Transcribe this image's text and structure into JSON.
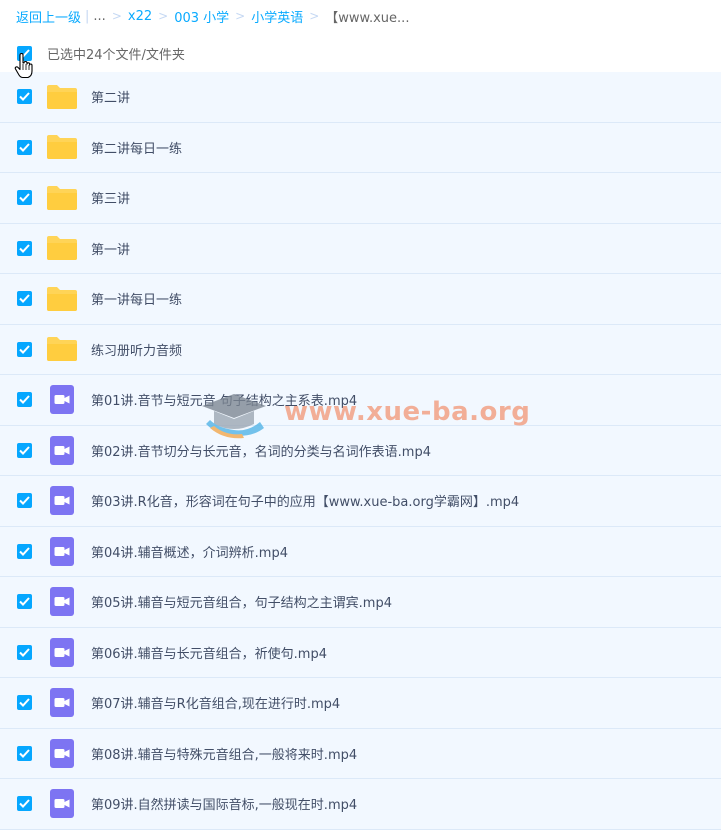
{
  "breadcrumb": {
    "back": "返回上一级",
    "ellipsis": "...",
    "items": [
      "x22",
      "003 小学",
      "小学英语"
    ],
    "current": "【www.xue..."
  },
  "selection": {
    "text": "已选中24个文件/文件夹"
  },
  "files": [
    {
      "name": "第二讲",
      "type": "folder"
    },
    {
      "name": "第二讲每日一练",
      "type": "folder"
    },
    {
      "name": "第三讲",
      "type": "folder"
    },
    {
      "name": "第一讲",
      "type": "folder"
    },
    {
      "name": "第一讲每日一练",
      "type": "folder"
    },
    {
      "name": "练习册听力音频",
      "type": "folder"
    },
    {
      "name": "第01讲.音节与短元音 句子结构之主系表.mp4",
      "type": "video"
    },
    {
      "name": "第02讲.音节切分与长元音，名词的分类与名词作表语.mp4",
      "type": "video"
    },
    {
      "name": "第03讲.R化音，形容词在句子中的应用【www.xue-ba.org学霸网】.mp4",
      "type": "video"
    },
    {
      "name": "第04讲.辅音概述，介词辨析.mp4",
      "type": "video"
    },
    {
      "name": "第05讲.辅音与短元音组合，句子结构之主谓宾.mp4",
      "type": "video"
    },
    {
      "name": "第06讲.辅音与长元音组合，祈使句.mp4",
      "type": "video"
    },
    {
      "name": "第07讲.辅音与R化音组合,现在进行时.mp4",
      "type": "video"
    },
    {
      "name": "第08讲.辅音与特殊元音组合,一般将来时.mp4",
      "type": "video"
    },
    {
      "name": "第09讲.自然拼读与国际音标,一般现在时.mp4",
      "type": "video"
    }
  ],
  "watermark": {
    "text": "www.xue-ba.org"
  },
  "colors": {
    "accent": "#06a7ff",
    "row_bg": "#f2f8ff",
    "folder": "#ffd457",
    "video": "#7d74f2"
  }
}
